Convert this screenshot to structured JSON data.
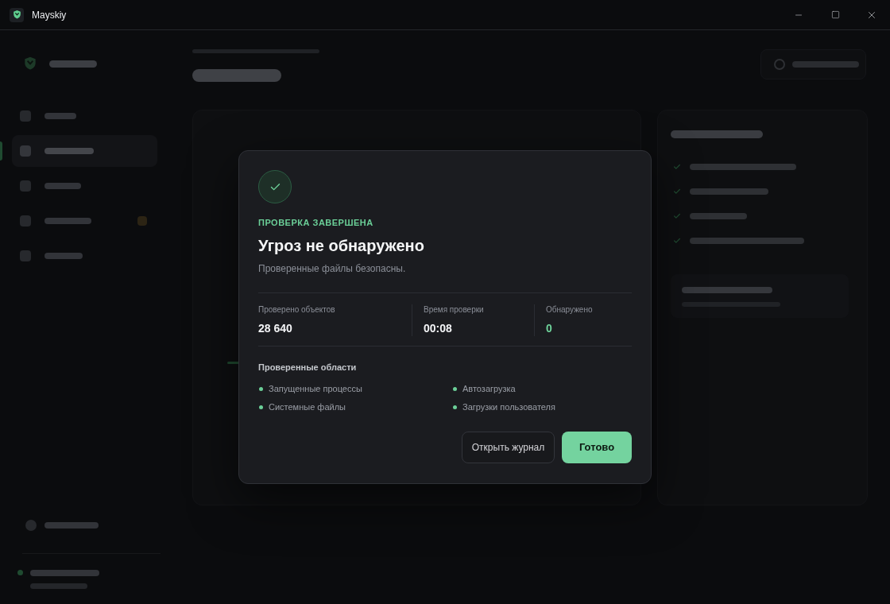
{
  "window": {
    "title": "Mayskiy"
  },
  "sidebar": {
    "items": [
      {
        "selected": false,
        "alert": false
      },
      {
        "selected": true,
        "alert": false
      },
      {
        "selected": false,
        "alert": false
      },
      {
        "selected": false,
        "alert": true
      },
      {
        "selected": false,
        "alert": false
      }
    ]
  },
  "dialog": {
    "eyebrow": "ПРОВЕРКА ЗАВЕРШЕНА",
    "title": "Угроз не обнаружено",
    "subtitle": "Проверенные файлы безопасны.",
    "stats": [
      {
        "label": "Проверено объектов",
        "value": "28 640",
        "kind": "neutral"
      },
      {
        "label": "Время проверки",
        "value": "00:08",
        "kind": "neutral"
      },
      {
        "label": "Обнаружено",
        "value": "0",
        "kind": "success"
      }
    ],
    "areas_title": "Проверенные области",
    "areas": [
      "Запущенные процессы",
      "Автозагрузка",
      "Системные файлы",
      "Загрузки пользователя"
    ],
    "buttons": [
      {
        "label": "Открыть журнал",
        "kind": "secondary"
      },
      {
        "label": "Готово",
        "kind": "primary"
      }
    ]
  }
}
